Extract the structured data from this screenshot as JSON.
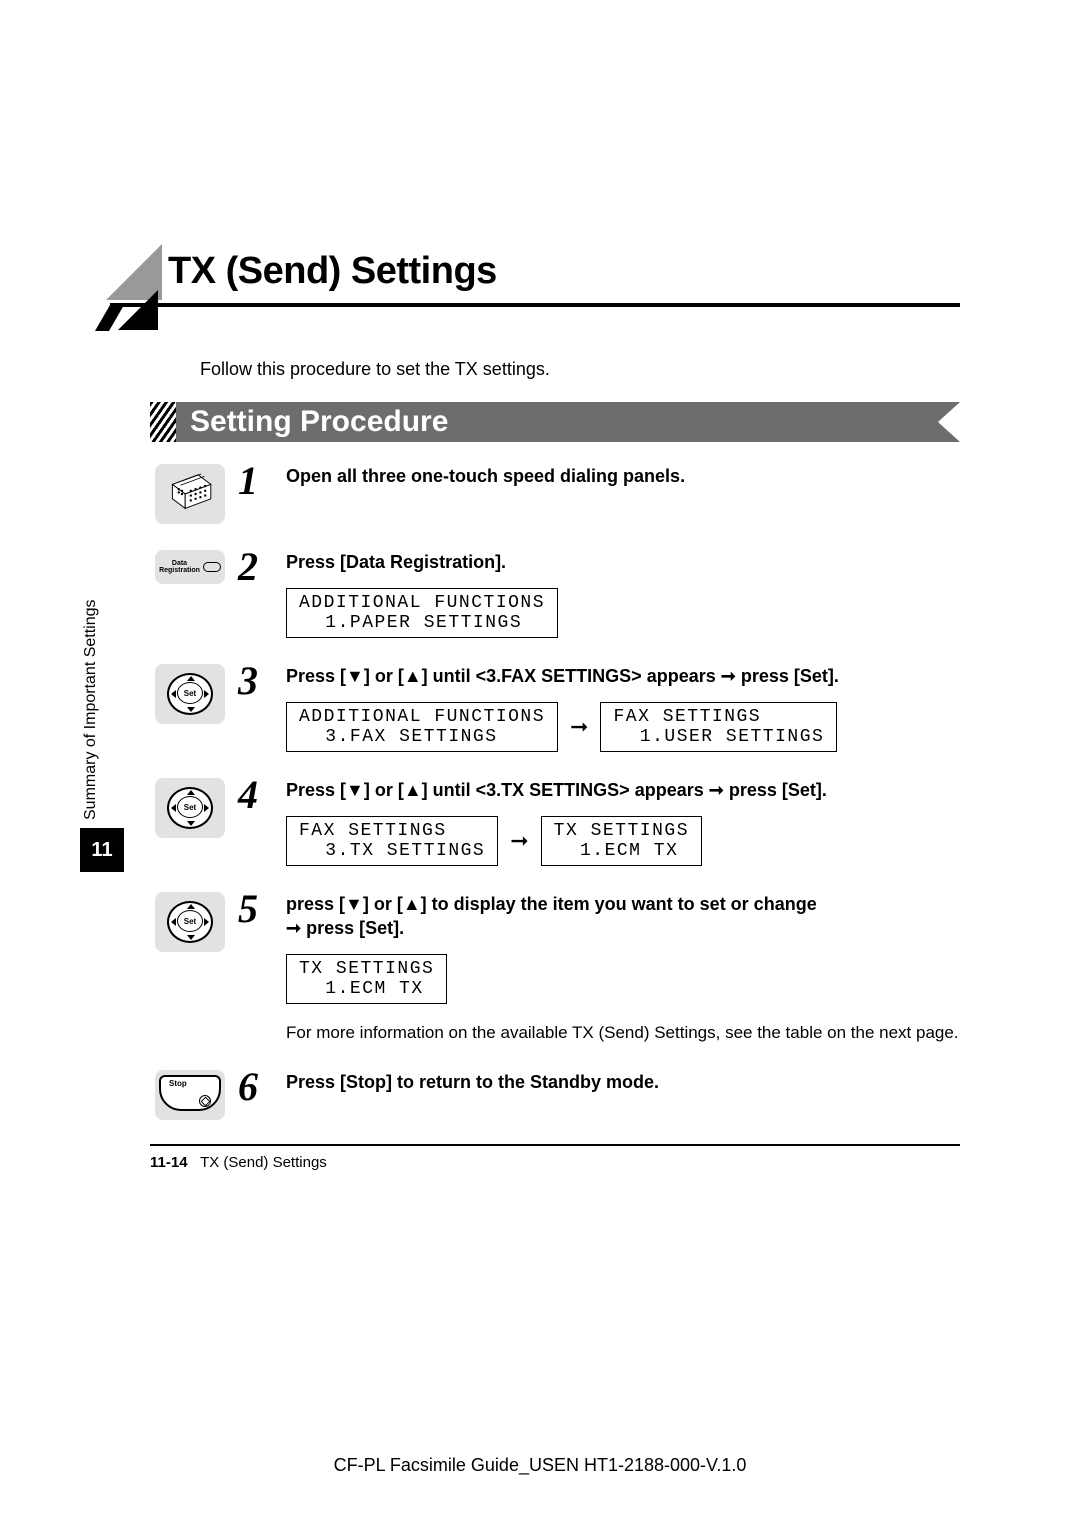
{
  "chapter_title": "TX (Send) Settings",
  "intro": "Follow this procedure to set the TX settings.",
  "section_title": "Setting Procedure",
  "chapter_number": "11",
  "sidebar_text": "Summary of Important Settings",
  "steps": {
    "s1": {
      "num": "1",
      "text": "Open all three one-touch speed dialing panels."
    },
    "s2": {
      "num": "2",
      "text": "Press [Data Registration].",
      "icon_label": "Data\nRegistration",
      "lcd1_line1": "ADDITIONAL FUNCTIONS",
      "lcd1_line2": " 1.PAPER SETTINGS"
    },
    "s3": {
      "num": "3",
      "text_a": "Press [▼] or [▲] until <3.FAX SETTINGS> appears ",
      "text_b": " press [Set].",
      "icon_label": "Set",
      "lcd1_line1": "ADDITIONAL FUNCTIONS",
      "lcd1_line2": " 3.FAX SETTINGS",
      "lcd2_line1": "FAX SETTINGS",
      "lcd2_line2": " 1.USER SETTINGS"
    },
    "s4": {
      "num": "4",
      "text_a": "Press [▼] or [▲] until <3.TX SETTINGS> appears ",
      "text_b": " press [Set].",
      "icon_label": "Set",
      "lcd1_line1": "FAX SETTINGS",
      "lcd1_line2": " 3.TX SETTINGS",
      "lcd2_line1": "TX SETTINGS",
      "lcd2_line2": " 1.ECM TX"
    },
    "s5": {
      "num": "5",
      "text_a": "press [▼] or [▲] to display the item you want to set or change ",
      "text_b": " press [Set].",
      "icon_label": "Set",
      "lcd1_line1": "TX SETTINGS",
      "lcd1_line2": " 1.ECM TX",
      "note": "For more information on the available TX (Send) Settings, see the table on the next page."
    },
    "s6": {
      "num": "6",
      "text": "Press [Stop] to return to the Standby mode.",
      "icon_label": "Stop"
    }
  },
  "arrow_glyph": "➞",
  "footer_page": "11-14",
  "footer_title": "TX (Send) Settings",
  "doc_id": "CF-PL Facsimile Guide_USEN HT1-2188-000-V.1.0"
}
